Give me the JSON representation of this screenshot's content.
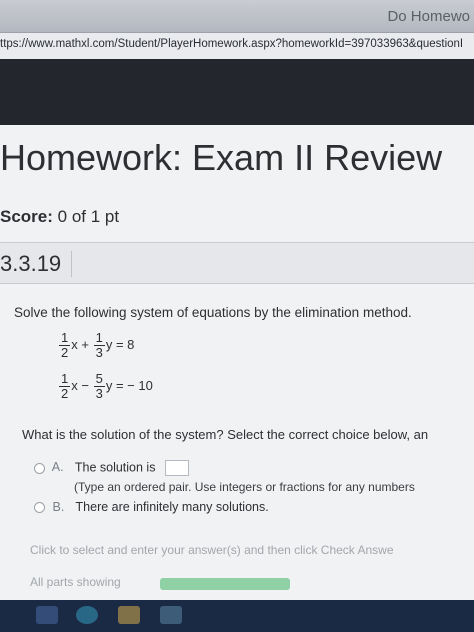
{
  "window": {
    "title": "Do Homewo"
  },
  "browser": {
    "url": "ttps://www.mathxl.com/Student/PlayerHomework.aspx?homeworkId=397033963&questionI"
  },
  "page": {
    "heading": "Homework: Exam II Review",
    "score_label": "Score:",
    "score_value": "0 of 1 pt",
    "question_number": "3.3.19"
  },
  "question": {
    "instruction": "Solve the following system of equations by the elimination method.",
    "eq1": {
      "a_num": "1",
      "a_den": "2",
      "x": "x",
      "op": "+",
      "b_num": "1",
      "b_den": "3",
      "y": "y",
      "rhs": "= 8"
    },
    "eq2": {
      "a_num": "1",
      "a_den": "2",
      "x": "x",
      "op": "−",
      "b_num": "5",
      "b_den": "3",
      "y": "y",
      "rhs": "= − 10"
    },
    "prompt": "What is the solution of the system? Select the correct choice below, an",
    "choices": [
      {
        "letter": "A.",
        "text": "The solution is",
        "hint": "(Type an ordered pair. Use integers or fractions for any numbers"
      },
      {
        "letter": "B.",
        "text": "There are infinitely many solutions."
      }
    ]
  },
  "footer": {
    "hint": "Click to select and enter your answer(s) and then click Check Answe",
    "parts_showing": "All parts showing",
    "progress_fraction": 1.0
  },
  "colors": {
    "page_bg": "#f1f2f3",
    "chrome_dark": "#23262d",
    "progress_fill": "#8fd0a4"
  }
}
